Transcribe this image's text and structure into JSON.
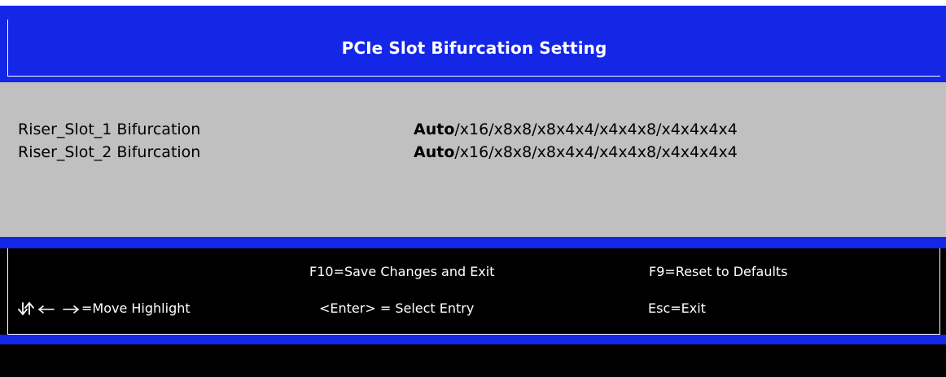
{
  "header": {
    "title": "PCIe Slot Bifurcation Setting"
  },
  "settings": [
    {
      "label": "Riser_Slot_1 Bifurcation",
      "selected": "Auto",
      "options_rest": "/x16/x8x8/x8x4x4/x4x4x8/x4x4x4x4"
    },
    {
      "label": "Riser_Slot_2 Bifurcation",
      "selected": "Auto",
      "options_rest": "/x16/x8x8/x8x4x4/x4x4x8/x4x4x4x4"
    }
  ],
  "footer": {
    "save_exit": "F10=Save Changes and Exit",
    "reset_defaults": "F9=Reset to Defaults",
    "move_highlight": "=Move Highlight",
    "select_entry": "<Enter> = Select Entry",
    "exit": "Esc=Exit",
    "arrow_icons": [
      "down-arrow-icon",
      "up-arrow-icon",
      "left-arrow-icon",
      "right-arrow-icon"
    ]
  },
  "colors": {
    "bios_blue": "#1426e6",
    "panel_gray": "#c0c0c0",
    "footer_black": "#000000",
    "text_white": "#ffffff"
  }
}
